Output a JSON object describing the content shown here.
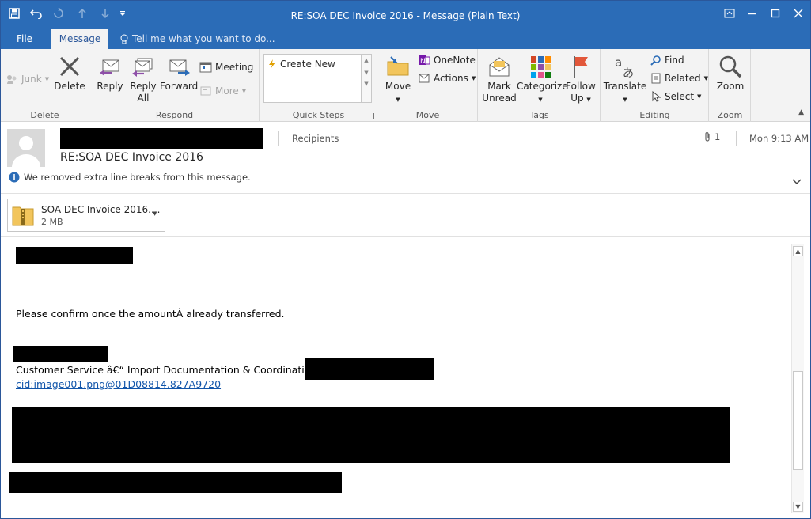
{
  "window": {
    "title": "RE:SOA DEC Invoice 2016 - Message (Plain Text)",
    "accent": "#2b6cb7"
  },
  "tabs": [
    {
      "label": "File"
    },
    {
      "label": "Message"
    }
  ],
  "tell_me": {
    "placeholder": "Tell me what you want to do..."
  },
  "ribbon": {
    "delete": {
      "junk": "Junk",
      "delete": "Delete",
      "group": "Delete"
    },
    "respond": {
      "reply": "Reply",
      "reply_all_1": "Reply",
      "reply_all_2": "All",
      "forward": "Forward",
      "meeting": "Meeting",
      "more": "More",
      "group": "Respond"
    },
    "quick_steps": {
      "create_new": "Create New",
      "group": "Quick Steps"
    },
    "move": {
      "move": "Move",
      "onenote": "OneNote",
      "actions": "Actions",
      "group": "Move"
    },
    "tags": {
      "mark_unread_1": "Mark",
      "mark_unread_2": "Unread",
      "categorize": "Categorize",
      "follow_up_1": "Follow",
      "follow_up_2": "Up",
      "group": "Tags"
    },
    "editing": {
      "translate": "Translate",
      "find": "Find",
      "related": "Related",
      "select": "Select",
      "group": "Editing"
    },
    "zoom": {
      "zoom": "Zoom",
      "group": "Zoom"
    }
  },
  "message": {
    "subject": "RE:SOA DEC Invoice 2016",
    "recipients_label": "Recipients",
    "attachment_count": "1",
    "time": "Mon 9:13 AM",
    "info_bar": "We removed extra line breaks from this message."
  },
  "attachment": {
    "name": "SOA DEC Invoice 2016....",
    "size": "2 MB"
  },
  "body": {
    "line1": "Please confirm once the amountÂ  already transferred.",
    "signature_line": "Customer Service â€“ Import Documentation & Coordination",
    "link": "cid:image001.png@01D08814.827A9720"
  }
}
